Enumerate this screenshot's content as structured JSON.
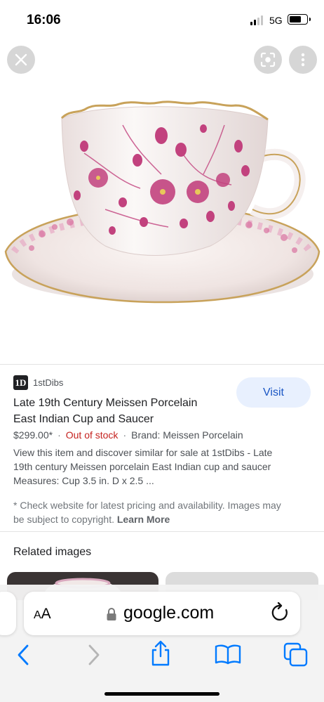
{
  "status_bar": {
    "time": "16:06",
    "network": "5G",
    "icons": [
      "signal-icon",
      "battery-icon"
    ]
  },
  "image_viewer": {
    "icons": [
      "close-icon",
      "lens-icon",
      "more-vert-icon"
    ],
    "image_subject": "porcelain-cup-and-saucer"
  },
  "result": {
    "source_logo": "1D",
    "source_name": "1stDibs",
    "visit_label": "Visit",
    "title_line1": "Late 19th Century Meissen Porcelain",
    "title_line2": "East Indian Cup and Saucer",
    "price": "$299.00*",
    "stock": "Out of stock",
    "brand": "Brand: Meissen Porcelain",
    "description_line1": "View this item and discover similar for sale at 1stDibs - Late",
    "description_line2": "19th century Meissen porcelain East Indian cup and saucer",
    "description_line3": "Measures: Cup 3.5 in. D x 2.5 ...",
    "disclaimer_line1": "* Check website for latest pricing and availability. Images may",
    "disclaimer_line2": "be subject to copyright.",
    "learn_more": "Learn More"
  },
  "related": {
    "title": "Related images"
  },
  "browser": {
    "aa_big": "A",
    "aa_small": "A",
    "url": "google.com",
    "toolbar_icons": [
      "back-icon",
      "forward-icon",
      "share-icon",
      "bookmarks-icon",
      "tabs-icon"
    ]
  },
  "colors": {
    "accent_blue": "#1a56c4",
    "visit_bg": "#e8f0fe",
    "out_of_stock": "#c5221f",
    "toolbar_blue": "#007aff"
  }
}
